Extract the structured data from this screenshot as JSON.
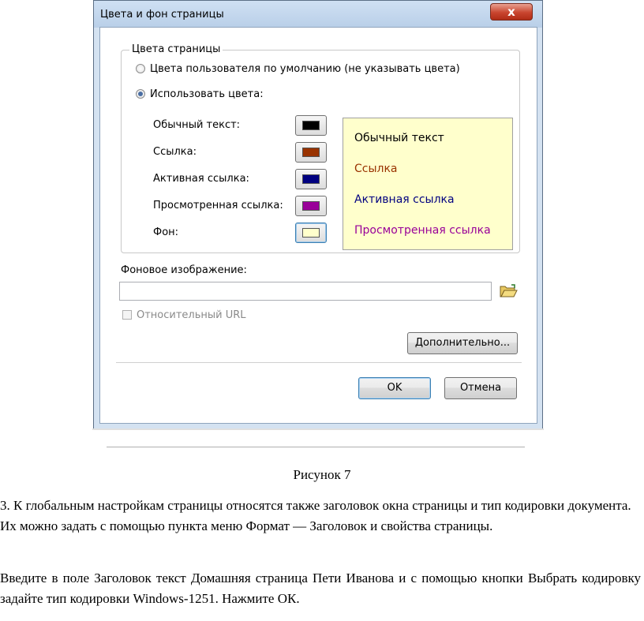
{
  "dialog": {
    "title": "Цвета и фон страницы",
    "close_label": "x",
    "group_title": "Цвета страницы",
    "radio_default_label": "Цвета пользователя по умолчанию (не указывать цвета)",
    "radio_custom_label": "Использовать цвета:",
    "radio_custom_checked": true,
    "colors": [
      {
        "label": "Обычный текст:",
        "swatch": "#000000"
      },
      {
        "label": "Ссылка:",
        "swatch": "#993300"
      },
      {
        "label": "Активная ссылка:",
        "swatch": "#000080"
      },
      {
        "label": "Просмотренная ссылка:",
        "swatch": "#990099"
      },
      {
        "label": "Фон:",
        "swatch": "#ffffcc"
      }
    ],
    "preview": {
      "background": "#ffffcc",
      "lines": [
        {
          "text": "Обычный текст",
          "color": "#000000"
        },
        {
          "text": "Ссылка",
          "color": "#993300"
        },
        {
          "text": "Активная ссылка",
          "color": "#000080"
        },
        {
          "text": "Просмотренная ссылка",
          "color": "#990099"
        }
      ]
    },
    "background_image_label": "Фоновое изображение:",
    "background_image_value": "",
    "browse_icon": "folder-open-icon",
    "relative_url_label": "Относительный URL",
    "relative_url_checked": false,
    "advanced_button": "Дополнительно...",
    "ok_button": "OK",
    "cancel_button": "Отмена"
  },
  "document": {
    "caption": "Рисунок 7",
    "paragraph1": "3. К глобальным настройкам страницы относятся также заголовок окна страницы и тип кодировки документа. Их можно задать с помощью пункта меню Формат — Заголовок и свойства страницы.",
    "paragraph2": "Введите в поле Заголовок текст Домашняя страница Пети Иванова и с помощью кнопки Выбрать кодировку задайте тип кодировки Windows-1251. Нажмите ОК."
  }
}
